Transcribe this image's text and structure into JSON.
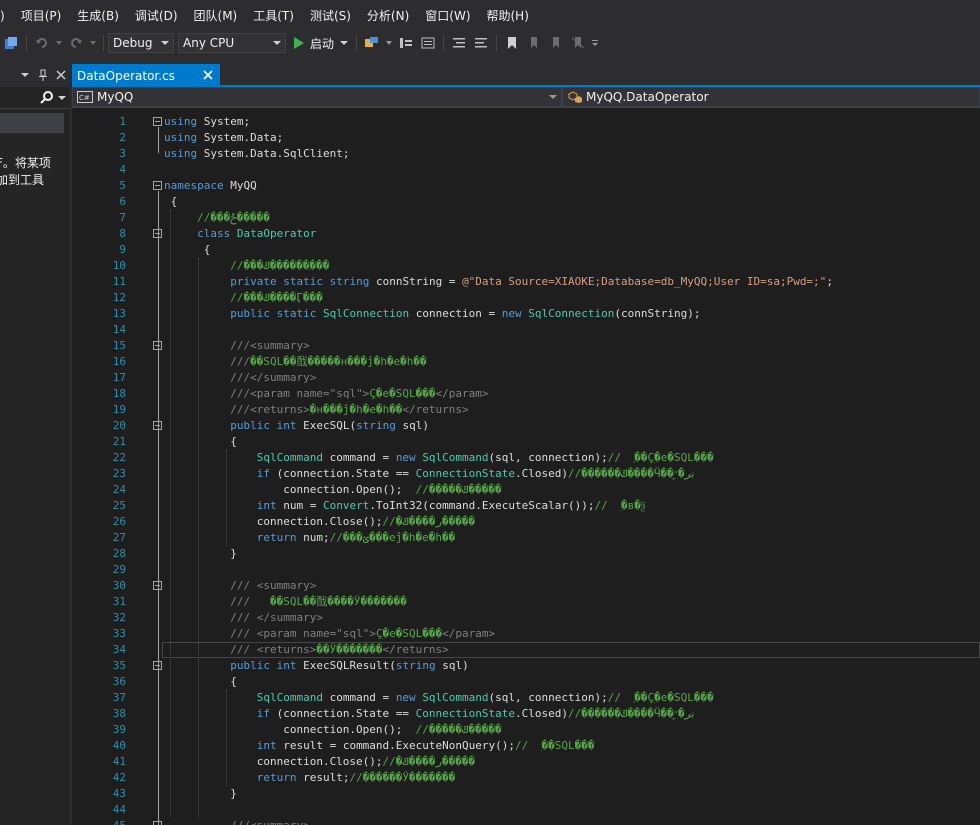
{
  "menu": [
    ")",
    "项目(P)",
    "生成(B)",
    "调试(D)",
    "团队(M)",
    "工具(T)",
    "测试(S)",
    "分析(N)",
    "窗口(W)",
    "帮助(H)"
  ],
  "toolbar": {
    "config": "Debug",
    "platform": "Any CPU",
    "start_label": "启动"
  },
  "left_panel": {
    "text_line1": "F。将某项",
    "text_line2": "加到工具"
  },
  "tab": {
    "title": "DataOperator.cs"
  },
  "nav": {
    "project": "MyQQ",
    "class": "MyQQ.DataOperator"
  },
  "lines": [
    {
      "n": "1",
      "h": "<span class='kw'>using</span> System;"
    },
    {
      "n": "2",
      "h": "<span class='kw'>using</span> System.Data;"
    },
    {
      "n": "3",
      "h": "<span class='kw'>using</span> System.Data.SqlClient;"
    },
    {
      "n": "4",
      "h": ""
    },
    {
      "n": "5",
      "h": "<span class='kw'>namespace</span> MyQQ"
    },
    {
      "n": "6",
      "h": " {"
    },
    {
      "n": "7",
      "h": "     <span class='cm'>//���ݲ�����</span>"
    },
    {
      "n": "8",
      "h": "     <span class='kw'>class</span> <span class='ty'>DataOperator</span>"
    },
    {
      "n": "9",
      "h": "      {"
    },
    {
      "n": "10",
      "h": "          <span class='cm'>//���ݿ������ַ���</span>"
    },
    {
      "n": "11",
      "h": "          <span class='kw'>private</span> <span class='kw'>static</span> <span class='kw'>string</span> connString = <span class='st'>@\"Data Source=XIAOKE;Database=db_MyQQ;User ID=sa;Pwd=;\"</span>;"
    },
    {
      "n": "12",
      "h": "          <span class='cm'>//���ݿ����Ӷ���</span>"
    },
    {
      "n": "13",
      "h": "          <span class='kw'>public</span> <span class='kw'>static</span> <span class='ty'>SqlConnection</span> connection = <span class='kw'>new</span> <span class='ty'>SqlConnection</span>(connString);"
    },
    {
      "n": "14",
      "h": ""
    },
    {
      "n": "15",
      "h": "          <span class='xd'>///&lt;summary&gt;</span>"
    },
    {
      "n": "16",
      "h": "          <span class='xd'>///</span><span class='cm'>��SQL��䣬����ִ�н���ĵ�һ�е�һ��</span>"
    },
    {
      "n": "17",
      "h": "          <span class='xd'>///&lt;/summary&gt;</span>"
    },
    {
      "n": "18",
      "h": "          <span class='xd'>///&lt;param name=\"sql\"&gt;</span><span class='cm'>Ҫִ�е�SQL���</span><span class='xd'>&lt;/param&gt;</span>"
    },
    {
      "n": "19",
      "h": "          <span class='xd'>///&lt;returns&gt;</span><span class='cm'>ִ�н���ĵ�һ�е�һ��</span><span class='xd'>&lt;/returns&gt;</span>"
    },
    {
      "n": "20",
      "h": "          <span class='kw'>public</span> <span class='kw'>int</span> ExecSQL(<span class='kw'>string</span> sql)"
    },
    {
      "n": "21",
      "h": "          {"
    },
    {
      "n": "22",
      "h": "              <span class='ty'>SqlCommand</span> command = <span class='kw'>new</span> <span class='ty'>SqlCommand</span>(sql, connection);<span class='cm'>//  ָ��Ҫִ�е�SQL���</span>"
    },
    {
      "n": "23",
      "h": "              <span class='kw'>if</span> (connection.State == <span class='ty'>ConnectionState</span>.Closed)<span class='cm'>//������ݿ����Ӵ��ڹر�״̬</span>"
    },
    {
      "n": "24",
      "h": "                  connection.Open();  <span class='cm'>//�����ݿ�����</span>"
    },
    {
      "n": "25",
      "h": "              <span class='kw'>int</span> num = <span class='ty'>Convert</span>.ToInt32(command.ExecuteScalar());<span class='cm'>//  ִ�в�ѯ</span>"
    },
    {
      "n": "26",
      "h": "              connection.Close();<span class='cm'>//�ر����ݿ�����</span>"
    },
    {
      "n": "27",
      "h": "              <span class='kw'>return</span> num;<span class='cm'>//���ؽ���еĵ�һ�е�һ��</span>"
    },
    {
      "n": "28",
      "h": "          }"
    },
    {
      "n": "29",
      "h": ""
    },
    {
      "n": "30",
      "h": "          <span class='xd'>/// &lt;summary&gt;</span>"
    },
    {
      "n": "31",
      "h": "          <span class='xd'>///</span>   <span class='cm'>��SQL��䣬����Ӱ�������</span>"
    },
    {
      "n": "32",
      "h": "          <span class='xd'>/// &lt;/summary&gt;</span>"
    },
    {
      "n": "33",
      "h": "          <span class='xd'>/// &lt;param name=\"sql\"&gt;</span><span class='cm'>Ҫִ�е�SQL���</span><span class='xd'>&lt;/param&gt;</span>"
    },
    {
      "n": "34",
      "h": "          <span class='xd'>/// &lt;returns&gt;</span><span class='cm'>��Ӱ�������</span><span class='xd'>&lt;/returns&gt;</span>"
    },
    {
      "n": "35",
      "h": "          <span class='kw'>public</span> <span class='kw'>int</span> ExecSQLResult(<span class='kw'>string</span> sql)"
    },
    {
      "n": "36",
      "h": "          {"
    },
    {
      "n": "37",
      "h": "              <span class='ty'>SqlCommand</span> command = <span class='kw'>new</span> <span class='ty'>SqlCommand</span>(sql, connection);<span class='cm'>//  ָ��Ҫִ�е�SQL���</span>"
    },
    {
      "n": "38",
      "h": "              <span class='kw'>if</span> (connection.State == <span class='ty'>ConnectionState</span>.Closed)<span class='cm'>//������ݿ����Ӵ��ڹر�״̬</span>"
    },
    {
      "n": "39",
      "h": "                  connection.Open();  <span class='cm'>//�����ݿ�����</span>"
    },
    {
      "n": "40",
      "h": "              <span class='kw'>int</span> result = command.ExecuteNonQuery();<span class='cm'>//  ִ��SQL���</span>"
    },
    {
      "n": "41",
      "h": "              connection.Close();<span class='cm'>//�ر����ݿ�����</span>"
    },
    {
      "n": "42",
      "h": "              <span class='kw'>return</span> result;<span class='cm'>//������Ӱ�������</span>"
    },
    {
      "n": "43",
      "h": "          }"
    },
    {
      "n": "44",
      "h": ""
    },
    {
      "n": "45",
      "h": "          <span class='xd'>///&lt;summary&gt;</span>"
    }
  ]
}
